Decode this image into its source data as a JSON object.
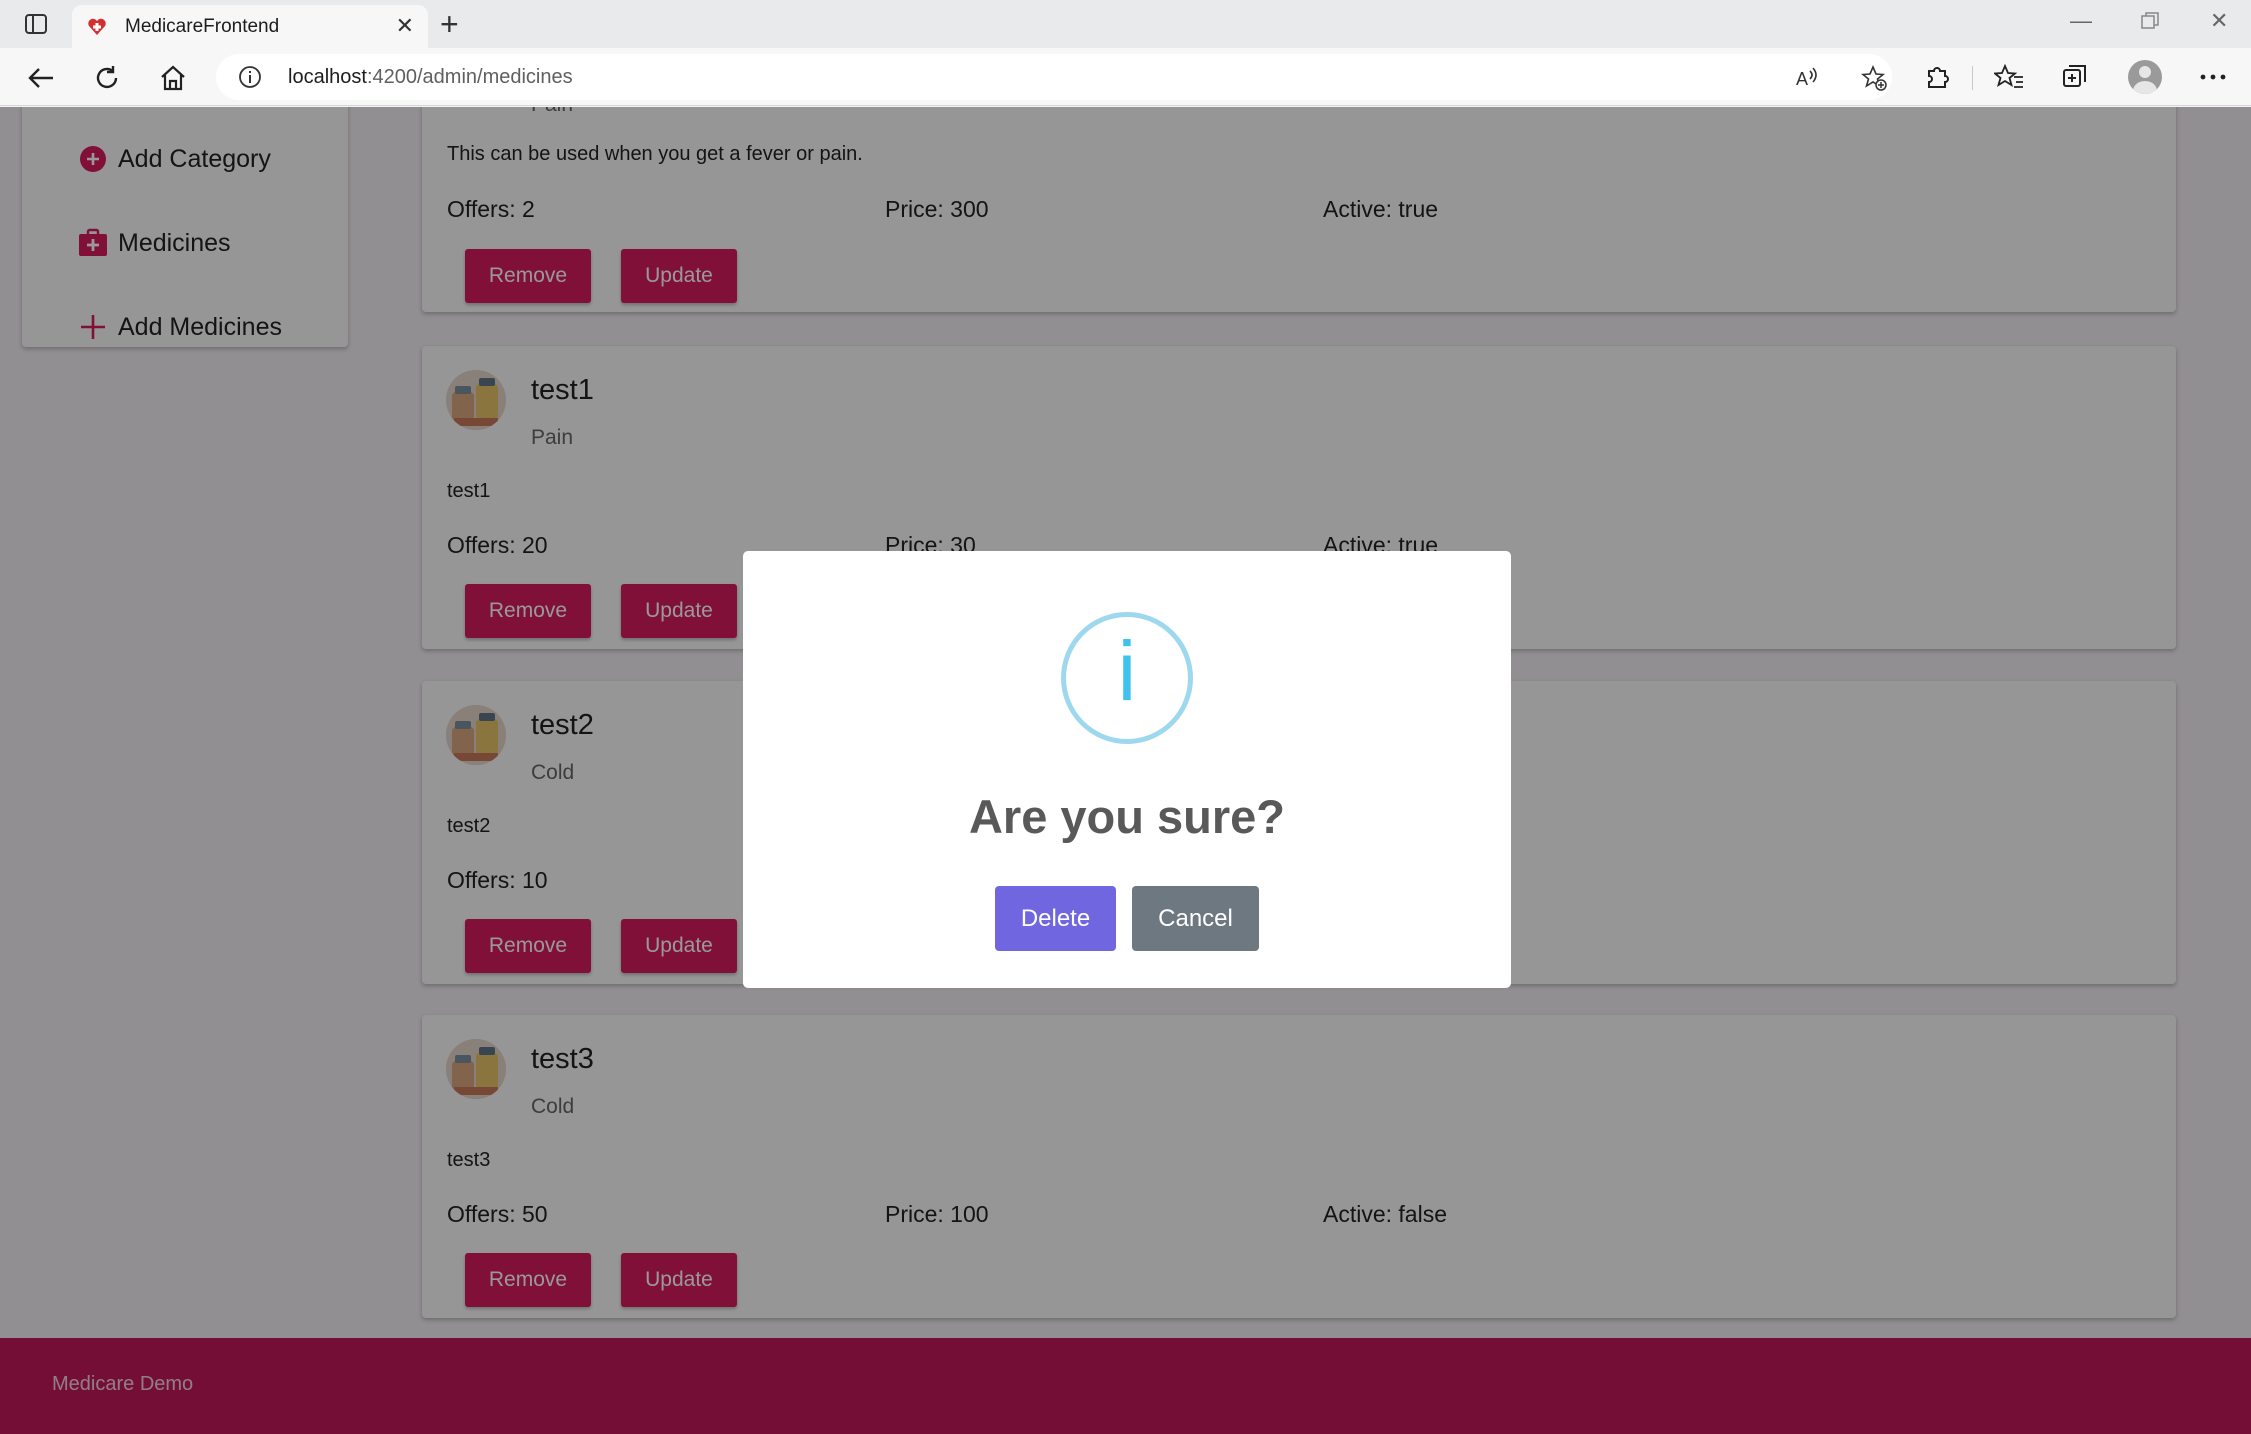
{
  "browser": {
    "tab_title": "MedicareFrontend",
    "url_host": "localhost",
    "url_path": ":4200/admin/medicines"
  },
  "sidebar": {
    "items": [
      {
        "label": "Add Category",
        "icon": "add-circle-icon"
      },
      {
        "label": "Medicines",
        "icon": "medical-bag-icon"
      },
      {
        "label": "Add Medicines",
        "icon": "plus-icon"
      }
    ]
  },
  "medicines": [
    {
      "name": "",
      "category": "Pain",
      "description": "This can be used when you get a fever or pain.",
      "offers": "Offers: 2",
      "price": "Price: 300",
      "active": "Active: true",
      "remove_label": "Remove",
      "update_label": "Update"
    },
    {
      "name": "test1",
      "category": "Pain",
      "description": "test1",
      "offers": "Offers: 20",
      "price": "Price: 30",
      "active": "Active: true",
      "remove_label": "Remove",
      "update_label": "Update"
    },
    {
      "name": "test2",
      "category": "Cold",
      "description": "test2",
      "offers": "Offers: 10",
      "price": "",
      "active": "",
      "remove_label": "Remove",
      "update_label": "Update"
    },
    {
      "name": "test3",
      "category": "Cold",
      "description": "test3",
      "offers": "Offers: 50",
      "price": "Price: 100",
      "active": "Active: false",
      "remove_label": "Remove",
      "update_label": "Update"
    }
  ],
  "footer": {
    "text": "Medicare Demo"
  },
  "dialog": {
    "icon_glyph": "i",
    "title": "Are you sure?",
    "confirm_label": "Delete",
    "cancel_label": "Cancel"
  },
  "colors": {
    "accent": "#d81b60",
    "footer": "#c2185b",
    "confirm": "#7066e0",
    "cancel": "#6e7881",
    "info": "#3fc3ee"
  }
}
